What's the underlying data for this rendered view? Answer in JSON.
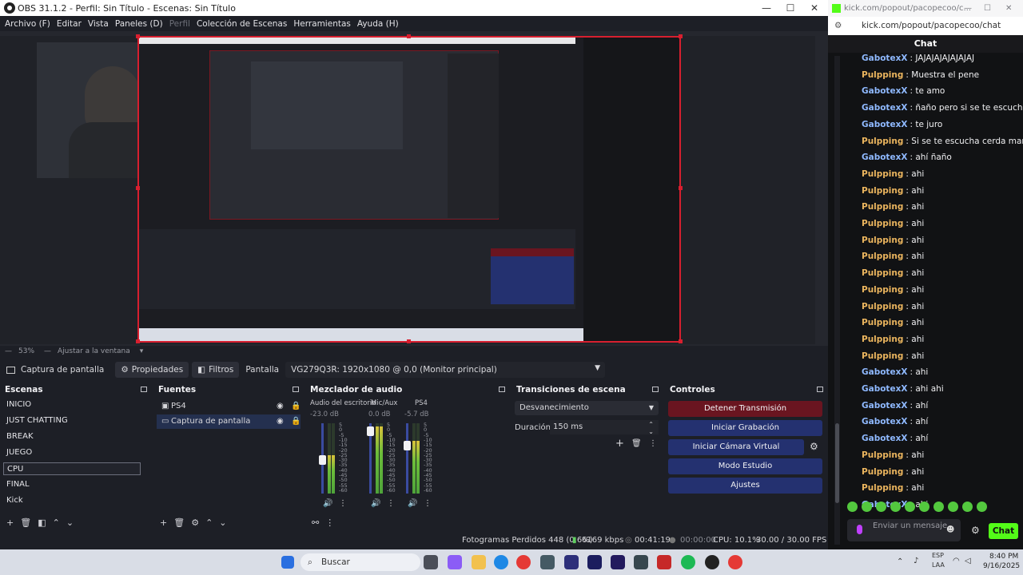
{
  "obs": {
    "title": "OBS 31.1.2 - Perfil: Sin Título - Escenas: Sin Título",
    "window_controls": {
      "minimize": "—",
      "maximize": "☐",
      "close": "✕"
    },
    "menu": [
      "Archivo (F)",
      "Editar",
      "Vista",
      "Paneles (D)",
      "Perfil",
      "Colección de Escenas",
      "Herramientas",
      "Ayuda (H)"
    ],
    "zoom": {
      "percent": "53%",
      "fit_label": "Ajustar a la ventana"
    },
    "source_toolbar": {
      "source_name": "Captura de pantalla",
      "properties_label": "Propiedades",
      "filters_label": "Filtros",
      "display_label": "Pantalla",
      "display_value": "VG279Q3R: 1920x1080 @ 0,0 (Monitor principal)"
    },
    "scenes": {
      "title": "Escenas",
      "items": [
        "INICIO",
        "JUST CHATTING",
        "BREAK",
        "JUEGO",
        "CPU",
        "FINAL",
        "Kick"
      ],
      "selected": "CPU"
    },
    "sources": {
      "title": "Fuentes",
      "items": [
        "PS4",
        "Captura de pantalla"
      ]
    },
    "mixer": {
      "title": "Mezclador de audio",
      "channels": [
        {
          "name": "Audio del escritorio",
          "db": "-23.0 dB",
          "level": 0.55
        },
        {
          "name": "Mic/Aux",
          "db": "0.0 dB",
          "level": 0.95
        },
        {
          "name": "PS4",
          "db": "-5.7 dB",
          "level": 0.75
        }
      ],
      "scale": [
        "5",
        "0",
        "-5",
        "-10",
        "-15",
        "-20",
        "-25",
        "-30",
        "-35",
        "-40",
        "-45",
        "-50",
        "-55",
        "-60"
      ]
    },
    "transitions": {
      "title": "Transiciones de escena",
      "type": "Desvanecimiento",
      "duration_label": "Duración",
      "duration_value": "150 ms"
    },
    "controls": {
      "title": "Controles",
      "buttons": [
        "Detener Transmisión",
        "Iniciar Grabación",
        "Iniciar Cámara Virtual",
        "Modo Estudio",
        "Ajustes"
      ]
    },
    "status": {
      "dropped_frames": "Fotogramas Perdidos 448 (0.6%)",
      "bitrate": "6169 kbps",
      "stream_time": "00:41:19",
      "rec_time": "00:00:00",
      "cpu": "CPU: 10.1%",
      "fps": "30.00 / 30.00 FPS"
    },
    "colors": {
      "accent_red": "#d71f2f",
      "button_blue": "#243170",
      "stop_button": "#6a1520"
    }
  },
  "chat": {
    "window_title": "kick.com/popout/pacopecoo/c...",
    "url": "kick.com/popout/pacopecoo/chat",
    "header": "Chat",
    "messages": [
      {
        "user": "GabotexX",
        "text": "JAJAJAJAJAJAJAJ",
        "badge": true
      },
      {
        "user": "Pulpping",
        "text": "Muestra el pene",
        "badge": false
      },
      {
        "user": "GabotexX",
        "text": "te amo",
        "badge": true
      },
      {
        "user": "GabotexX",
        "text": "ñaño pero si se te escucha doble",
        "badge": true
      },
      {
        "user": "GabotexX",
        "text": "te juro",
        "badge": true
      },
      {
        "user": "Pulpping",
        "text": "Si se te escucha cerda marrana",
        "badge": false
      },
      {
        "user": "GabotexX",
        "text": "ahí ñaño",
        "badge": true
      },
      {
        "user": "Pulpping",
        "text": "ahi",
        "badge": false
      },
      {
        "user": "Pulpping",
        "text": "ahi",
        "badge": false
      },
      {
        "user": "Pulpping",
        "text": "ahi",
        "badge": false
      },
      {
        "user": "Pulpping",
        "text": "ahi",
        "badge": false
      },
      {
        "user": "Pulpping",
        "text": "ahi",
        "badge": false
      },
      {
        "user": "Pulpping",
        "text": "ahi",
        "badge": false
      },
      {
        "user": "Pulpping",
        "text": "ahi",
        "badge": false
      },
      {
        "user": "Pulpping",
        "text": "ahi",
        "badge": false
      },
      {
        "user": "Pulpping",
        "text": "ahi",
        "badge": false
      },
      {
        "user": "Pulpping",
        "text": "ahi",
        "badge": false
      },
      {
        "user": "Pulpping",
        "text": "ahi",
        "badge": false
      },
      {
        "user": "Pulpping",
        "text": "ahi",
        "badge": false
      },
      {
        "user": "GabotexX",
        "text": "ahi",
        "badge": true
      },
      {
        "user": "GabotexX",
        "text": "ahi ahi",
        "badge": true
      },
      {
        "user": "GabotexX",
        "text": "ahí",
        "badge": true
      },
      {
        "user": "GabotexX",
        "text": "ahí",
        "badge": true
      },
      {
        "user": "GabotexX",
        "text": "ahí",
        "badge": true
      },
      {
        "user": "Pulpping",
        "text": "ahi",
        "badge": false
      },
      {
        "user": "Pulpping",
        "text": "ahi",
        "badge": false
      },
      {
        "user": "Pulpping",
        "text": "ahi",
        "badge": false
      },
      {
        "user": "GabotexX",
        "text": "ahi",
        "badge": true
      }
    ],
    "input_placeholder": "Enviar un mensaje",
    "send_label": "Chat",
    "accent": "#53fc18"
  },
  "taskbar": {
    "search_placeholder": "Buscar",
    "lang_top": "ESP",
    "lang_bottom": "LAA",
    "time": "8:40 PM",
    "date": "9/16/2025"
  }
}
